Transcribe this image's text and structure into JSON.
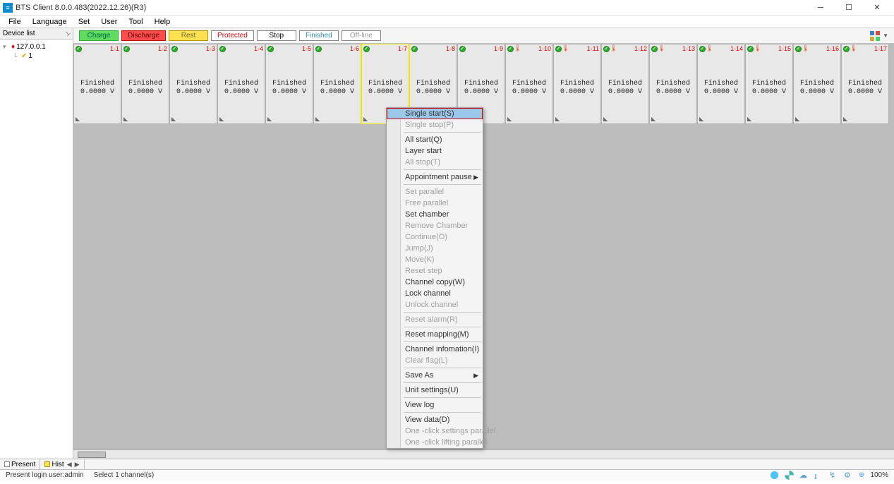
{
  "title": "BTS Client 8.0.0.483(2022.12.26)(R3)",
  "menu": {
    "file": "File",
    "language": "Language",
    "set": "Set",
    "user": "User",
    "tool": "Tool",
    "help": "Help"
  },
  "device_panel": {
    "title": "Device list",
    "root": "127.0.0.1",
    "child": "1"
  },
  "toolbar": {
    "charge": "Charge",
    "discharge": "Discharge",
    "rest": "Rest",
    "protected": "Protected",
    "stop": "Stop",
    "finished": "Finished",
    "offline": "Off-line"
  },
  "channels": [
    {
      "id": "1-1",
      "status": "Finished",
      "value": "0.0000 V",
      "thermo": false
    },
    {
      "id": "1-2",
      "status": "Finished",
      "value": "0.0000 V",
      "thermo": false
    },
    {
      "id": "1-3",
      "status": "Finished",
      "value": "0.0000 V",
      "thermo": false
    },
    {
      "id": "1-4",
      "status": "Finished",
      "value": "0.0000 V",
      "thermo": false
    },
    {
      "id": "1-5",
      "status": "Finished",
      "value": "0.0000 V",
      "thermo": false
    },
    {
      "id": "1-6",
      "status": "Finished",
      "value": "0.0000 V",
      "thermo": false
    },
    {
      "id": "1-7",
      "status": "Finished",
      "value": "0.0000 V",
      "thermo": false,
      "selected": true
    },
    {
      "id": "1-8",
      "status": "Finished",
      "value": "0.0000 V",
      "thermo": false
    },
    {
      "id": "1-9",
      "status": "Finished",
      "value": "0.0000 V",
      "thermo": false
    },
    {
      "id": "1-10",
      "status": "Finished",
      "value": "0.0000 V",
      "thermo": true
    },
    {
      "id": "1-11",
      "status": "Finished",
      "value": "0.0000 V",
      "thermo": true
    },
    {
      "id": "1-12",
      "status": "Finished",
      "value": "0.0000 V",
      "thermo": true
    },
    {
      "id": "1-13",
      "status": "Finished",
      "value": "0.0000 V",
      "thermo": true
    },
    {
      "id": "1-14",
      "status": "Finished",
      "value": "0.0000 V",
      "thermo": true
    },
    {
      "id": "1-15",
      "status": "Finished",
      "value": "0.0000 V",
      "thermo": true
    },
    {
      "id": "1-16",
      "status": "Finished",
      "value": "0.0000 V",
      "thermo": true
    },
    {
      "id": "1-17",
      "status": "Finished",
      "value": "0.0000 V",
      "thermo": true
    }
  ],
  "context_menu": [
    {
      "label": "Single start(S)",
      "enabled": true,
      "highlight": true
    },
    {
      "label": "Single stop(P)",
      "enabled": false
    },
    {
      "sep": true
    },
    {
      "label": "All start(Q)",
      "enabled": true
    },
    {
      "label": "Layer start",
      "enabled": true
    },
    {
      "label": "All stop(T)",
      "enabled": false
    },
    {
      "sep": true
    },
    {
      "label": "Appointment pause",
      "enabled": true,
      "submenu": true
    },
    {
      "sep": true
    },
    {
      "label": "Set parallel",
      "enabled": false
    },
    {
      "label": "Free parallel",
      "enabled": false
    },
    {
      "label": "Set chamber",
      "enabled": true
    },
    {
      "label": "Remove Chamber",
      "enabled": false
    },
    {
      "label": "Continue(O)",
      "enabled": false
    },
    {
      "label": "Jump(J)",
      "enabled": false
    },
    {
      "label": "Move(K)",
      "enabled": false
    },
    {
      "label": "Reset step",
      "enabled": false
    },
    {
      "label": "Channel copy(W)",
      "enabled": true
    },
    {
      "label": "Lock channel",
      "enabled": true
    },
    {
      "label": "Unlock channel",
      "enabled": false
    },
    {
      "sep": true
    },
    {
      "label": "Reset alarm(R)",
      "enabled": false
    },
    {
      "sep": true
    },
    {
      "label": "Reset mapping(M)",
      "enabled": true
    },
    {
      "sep": true
    },
    {
      "label": "Channel infomation(I)",
      "enabled": true
    },
    {
      "label": "Clear flag(L)",
      "enabled": false
    },
    {
      "sep": true
    },
    {
      "label": "Save As",
      "enabled": true,
      "submenu": true
    },
    {
      "sep": true
    },
    {
      "label": "Unit settings(U)",
      "enabled": true
    },
    {
      "sep": true
    },
    {
      "label": "View log",
      "enabled": true
    },
    {
      "sep": true
    },
    {
      "label": "View data(D)",
      "enabled": true
    },
    {
      "label": "One -click settings parallel",
      "enabled": false
    },
    {
      "label": "One -click lifting parallel",
      "enabled": false
    }
  ],
  "tabs": {
    "present": "Present",
    "hist": "Hist"
  },
  "statusbar": {
    "user": "Present login user:admin",
    "selection": "Select 1 channel(s)",
    "zoom": "100%"
  }
}
